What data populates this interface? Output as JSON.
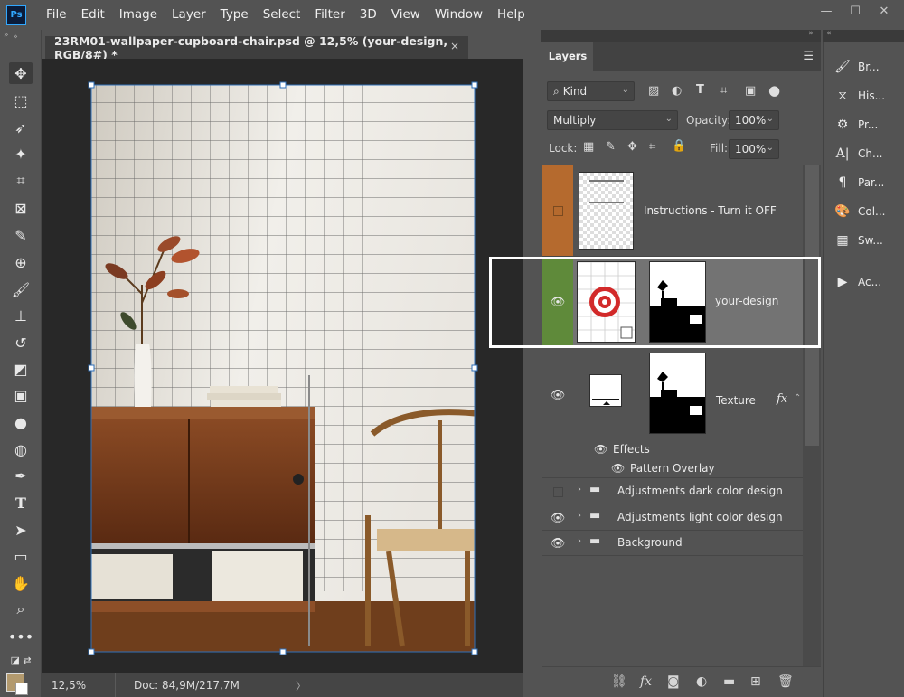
{
  "app": {
    "logo": "Ps"
  },
  "menu": [
    "File",
    "Edit",
    "Image",
    "Layer",
    "Type",
    "Select",
    "Filter",
    "3D",
    "View",
    "Window",
    "Help"
  ],
  "document": {
    "tab_title": "23RM01-wallpaper-cupboard-chair.psd @ 12,5% (your-design, RGB/8#) *",
    "close_glyph": "×"
  },
  "status": {
    "zoom": "12,5%",
    "doc": "Doc: 84,9M/217,7M",
    "arrow": "〉"
  },
  "layers_panel": {
    "tab": "Layers",
    "filter_kind": "Kind",
    "blend_mode": "Multiply",
    "opacity_label": "Opacity:",
    "opacity_value": "100%",
    "lock_label": "Lock:",
    "fill_label": "Fill:",
    "fill_value": "100%",
    "layers": [
      {
        "name": "Instructions - Turn it OFF",
        "visible": false,
        "color": "#b56a2e"
      },
      {
        "name": "your-design",
        "visible": true,
        "color": "#5f8a3a",
        "selected": true
      },
      {
        "name": "Texture",
        "visible": true,
        "fx": "fx",
        "effects_label": "Effects",
        "effect": "Pattern Overlay"
      },
      {
        "name": "Adjustments dark color design",
        "visible": false,
        "group": true
      },
      {
        "name": "Adjustments light color design",
        "visible": true,
        "group": true
      },
      {
        "name": "Background",
        "visible": true,
        "group": true
      }
    ]
  },
  "dock": [
    {
      "label": "Br...",
      "icon": "brush-settings-icon"
    },
    {
      "label": "His...",
      "icon": "history-icon"
    },
    {
      "label": "Pr...",
      "icon": "properties-icon"
    },
    {
      "label": "Ch...",
      "icon": "character-icon"
    },
    {
      "label": "Par...",
      "icon": "paragraph-icon"
    },
    {
      "label": "Col...",
      "icon": "color-icon"
    },
    {
      "label": "Sw...",
      "icon": "swatches-icon"
    },
    {
      "label": "Ac...",
      "icon": "actions-icon"
    }
  ],
  "colors": {
    "foreground": "#b39a6e",
    "background": "#ffffff",
    "instructions_label": "#b56a2e",
    "design_label": "#5f8a3a"
  }
}
